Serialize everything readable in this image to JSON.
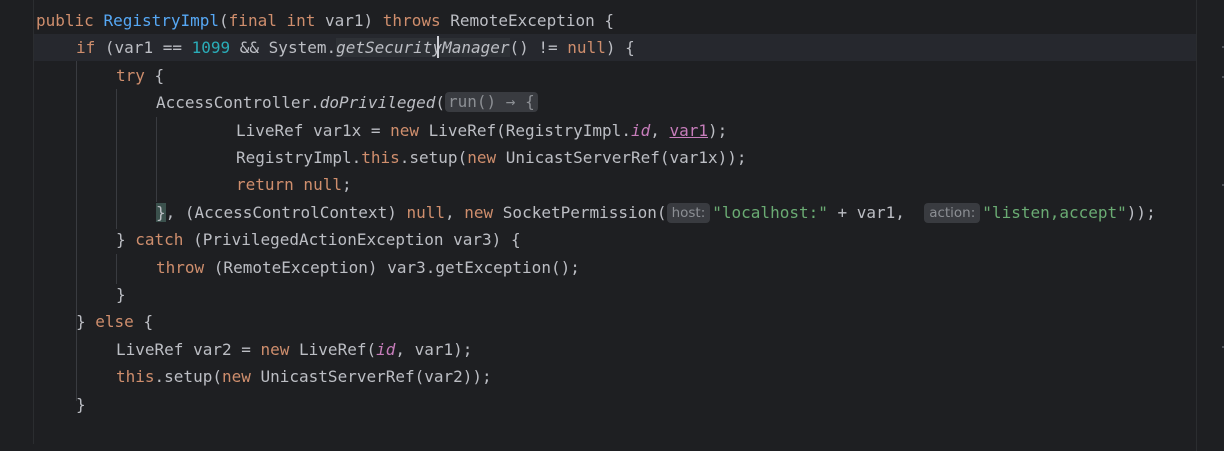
{
  "editor": {
    "lines": [
      {
        "tokens": [
          {
            "text": "public ",
            "cls": "kw"
          },
          {
            "text": "RegistryImpl",
            "cls": "fn"
          },
          {
            "text": "(",
            "cls": "plain"
          },
          {
            "text": "final int ",
            "cls": "kw"
          },
          {
            "text": "var1) ",
            "cls": "plain"
          },
          {
            "text": "throws ",
            "cls": "kw"
          },
          {
            "text": "RemoteException {",
            "cls": "plain"
          }
        ]
      },
      {
        "tokens": [
          {
            "text": "if ",
            "cls": "kw"
          },
          {
            "text": "(var1 == ",
            "cls": "plain"
          },
          {
            "text": "1099",
            "cls": "num"
          },
          {
            "text": " && System.",
            "cls": "plain"
          },
          {
            "text": "getSecurityManager",
            "cls": "italic highlighted"
          },
          {
            "text": "() != ",
            "cls": "plain"
          },
          {
            "text": "null",
            "cls": "kw"
          },
          {
            "text": ") {",
            "cls": "plain"
          }
        ]
      },
      {
        "tokens": [
          {
            "text": "try ",
            "cls": "kw"
          },
          {
            "text": "{",
            "cls": "plain"
          }
        ]
      },
      {
        "tokens": [
          {
            "text": "AccessController.",
            "cls": "plain"
          },
          {
            "text": "doPrivileged",
            "cls": "italic"
          },
          {
            "text": "(",
            "cls": "plain"
          },
          {
            "text": "run() → {",
            "cls": "lambda-hint"
          }
        ]
      },
      {
        "tokens": [
          {
            "text": "LiveRef var1x = ",
            "cls": "plain"
          },
          {
            "text": "new ",
            "cls": "kw"
          },
          {
            "text": "LiveRef(RegistryImpl.",
            "cls": "plain"
          },
          {
            "text": "id",
            "cls": "field"
          },
          {
            "text": ", ",
            "cls": "plain"
          },
          {
            "text": "var1",
            "cls": "usage-underline"
          },
          {
            "text": ");",
            "cls": "plain"
          }
        ]
      },
      {
        "tokens": [
          {
            "text": "RegistryImpl.",
            "cls": "plain"
          },
          {
            "text": "this",
            "cls": "kw"
          },
          {
            "text": ".setup(",
            "cls": "plain"
          },
          {
            "text": "new ",
            "cls": "kw"
          },
          {
            "text": "UnicastServerRef(var1x));",
            "cls": "plain"
          }
        ]
      },
      {
        "tokens": [
          {
            "text": "return null",
            "cls": "kw"
          },
          {
            "text": ";",
            "cls": "plain"
          }
        ]
      },
      {
        "tokens": [
          {
            "text": "}",
            "cls": "plain brace-match"
          },
          {
            "text": ", (AccessControlContext) ",
            "cls": "plain"
          },
          {
            "text": "null",
            "cls": "kw"
          },
          {
            "text": ", ",
            "cls": "plain"
          },
          {
            "text": "new ",
            "cls": "kw"
          },
          {
            "text": "SocketPermission(",
            "cls": "plain"
          },
          {
            "text": "host:",
            "cls": "hint"
          },
          {
            "text": "\"localhost:\"",
            "cls": "str"
          },
          {
            "text": " + var1,  ",
            "cls": "plain"
          },
          {
            "text": "action:",
            "cls": "hint"
          },
          {
            "text": "\"listen,accept\"",
            "cls": "str"
          },
          {
            "text": "));",
            "cls": "plain"
          }
        ]
      },
      {
        "tokens": [
          {
            "text": "} ",
            "cls": "plain"
          },
          {
            "text": "catch ",
            "cls": "kw"
          },
          {
            "text": "(PrivilegedActionException var3) {",
            "cls": "plain"
          }
        ]
      },
      {
        "tokens": [
          {
            "text": "throw ",
            "cls": "kw"
          },
          {
            "text": "(RemoteException) var3.getException();",
            "cls": "plain"
          }
        ]
      },
      {
        "tokens": [
          {
            "text": "}",
            "cls": "plain"
          }
        ]
      },
      {
        "tokens": [
          {
            "text": "} ",
            "cls": "plain"
          },
          {
            "text": "else ",
            "cls": "kw"
          },
          {
            "text": "{",
            "cls": "plain"
          }
        ]
      },
      {
        "tokens": [
          {
            "text": "LiveRef var2 = ",
            "cls": "plain"
          },
          {
            "text": "new ",
            "cls": "kw"
          },
          {
            "text": "LiveRef(",
            "cls": "plain"
          },
          {
            "text": "id",
            "cls": "field"
          },
          {
            "text": ", var1);",
            "cls": "plain"
          }
        ]
      },
      {
        "tokens": [
          {
            "text": "this",
            "cls": "kw"
          },
          {
            "text": ".setup(",
            "cls": "plain"
          },
          {
            "text": "new ",
            "cls": "kw"
          },
          {
            "text": "UnicastServerRef(var2));",
            "cls": "plain"
          }
        ]
      },
      {
        "tokens": [
          {
            "text": "}",
            "cls": "plain"
          }
        ]
      }
    ]
  },
  "colors": {
    "background": "#1e1f22",
    "keyword": "#cf8e6d",
    "function_decl": "#56a8f5",
    "number": "#2aacb8",
    "string": "#6aab73",
    "field": "#c77dbb",
    "text": "#bcbec4"
  }
}
